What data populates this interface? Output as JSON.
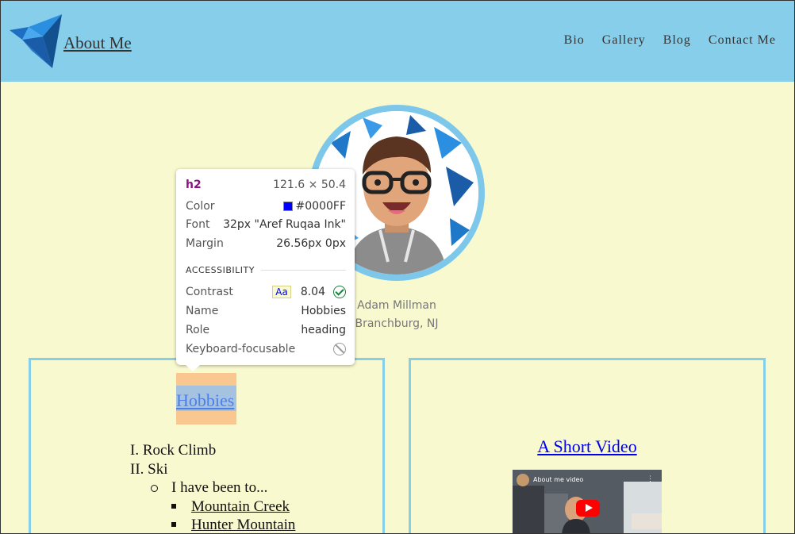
{
  "header": {
    "title": "About Me",
    "nav": [
      "Bio",
      "Gallery",
      "Blog",
      "Contact Me"
    ],
    "logo_icon": "origami-bird-icon",
    "background": "#87ceeb"
  },
  "profile": {
    "name": "Adam Millman",
    "location": "Branchburg, NJ"
  },
  "hobbies": {
    "heading": "Hobbies",
    "items": [
      {
        "marker": "I.",
        "text": "Rock Climb"
      },
      {
        "marker": "II.",
        "text": "Ski"
      }
    ],
    "sub_text": "I have been to...",
    "places": [
      "Mountain Creek",
      "Hunter Mountain"
    ]
  },
  "video": {
    "heading": "A Short Video",
    "caption": "About me video",
    "more_icon": "more-vertical-icon",
    "play_icon": "youtube-play-icon"
  },
  "inspector": {
    "tag": "h2",
    "dimensions": "121.6 × 50.4",
    "color_label": "Color",
    "color_value": "#0000FF",
    "font_label": "Font",
    "font_value": "32px \"Aref Ruqaa Ink\"",
    "margin_label": "Margin",
    "margin_value": "26.56px 0px",
    "section_title": "ACCESSIBILITY",
    "contrast_label": "Contrast",
    "contrast_sample": "Aa",
    "contrast_value": "8.04",
    "name_label": "Name",
    "name_value": "Hobbies",
    "role_label": "Role",
    "role_value": "heading",
    "keyboard_label": "Keyboard-focusable"
  },
  "colors": {
    "page_bg": "#f9f9d0",
    "accent": "#87ceeb",
    "link": "#0000ee",
    "highlight_margin": "#f8c890",
    "highlight_content": "#a5c2e0"
  }
}
